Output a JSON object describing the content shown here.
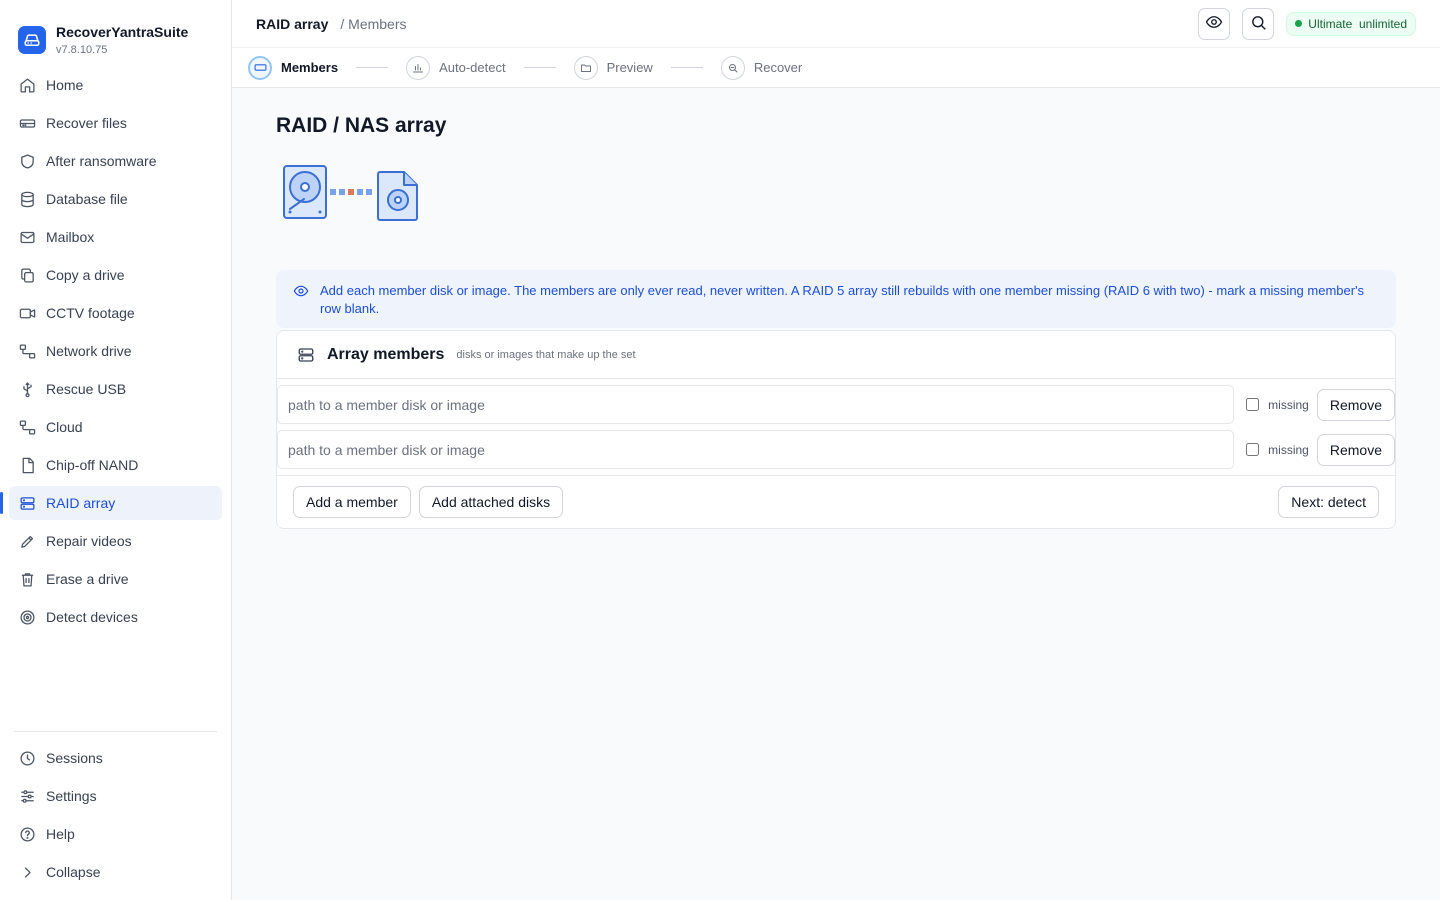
{
  "brand": {
    "name": "RecoverYantraSuite",
    "version": "v7.8.10.75"
  },
  "sidebar": {
    "items": [
      {
        "label": "Home",
        "icon": "home-icon"
      },
      {
        "label": "Recover files",
        "icon": "drive-icon"
      },
      {
        "label": "After ransomware",
        "icon": "shield-icon"
      },
      {
        "label": "Database file",
        "icon": "database-icon"
      },
      {
        "label": "Mailbox",
        "icon": "mail-icon"
      },
      {
        "label": "Copy a drive",
        "icon": "copy-icon"
      },
      {
        "label": "CCTV footage",
        "icon": "video-icon"
      },
      {
        "label": "Network drive",
        "icon": "network-icon"
      },
      {
        "label": "Rescue USB",
        "icon": "usb-icon"
      },
      {
        "label": "Cloud",
        "icon": "cloud-icon"
      },
      {
        "label": "Chip-off NAND",
        "icon": "file-icon"
      },
      {
        "label": "RAID array",
        "icon": "server-icon",
        "active": true
      },
      {
        "label": "Repair videos",
        "icon": "pen-icon"
      },
      {
        "label": "Erase a drive",
        "icon": "trash-icon"
      },
      {
        "label": "Detect devices",
        "icon": "target-icon"
      }
    ],
    "bottom": [
      {
        "label": "Sessions",
        "icon": "clock-icon"
      },
      {
        "label": "Settings",
        "icon": "sliders-icon"
      },
      {
        "label": "Help",
        "icon": "help-icon"
      },
      {
        "label": "Collapse",
        "icon": "chevron-right-icon"
      }
    ]
  },
  "topbar": {
    "title": "RAID array",
    "subtitle": "/ Members",
    "plan": "Ultimate  unlimited"
  },
  "steps": [
    {
      "label": "Members",
      "active": true
    },
    {
      "label": "Auto-detect"
    },
    {
      "label": "Preview"
    },
    {
      "label": "Recover"
    }
  ],
  "page": {
    "title": "RAID / NAS array",
    "info": "Add each member disk or image. The members are only ever read, never written. A RAID 5 array still rebuilds with one member missing (RAID 6 with two) - mark a missing member's row blank."
  },
  "card": {
    "title": "Array members",
    "subtitle": "disks or images that make up the set",
    "rows": [
      {
        "value": "",
        "placeholder": "path to a member disk or image",
        "missing_label": "missing",
        "missing": false,
        "remove_label": "Remove"
      },
      {
        "value": "",
        "placeholder": "path to a member disk or image",
        "missing_label": "missing",
        "missing": false,
        "remove_label": "Remove"
      }
    ],
    "add_member_label": "Add a member",
    "add_attached_label": "Add attached disks",
    "next_label": "Next: detect"
  },
  "colors": {
    "accent": "#2563eb",
    "info_bg": "#eef3fc",
    "success": "#16a34a"
  }
}
